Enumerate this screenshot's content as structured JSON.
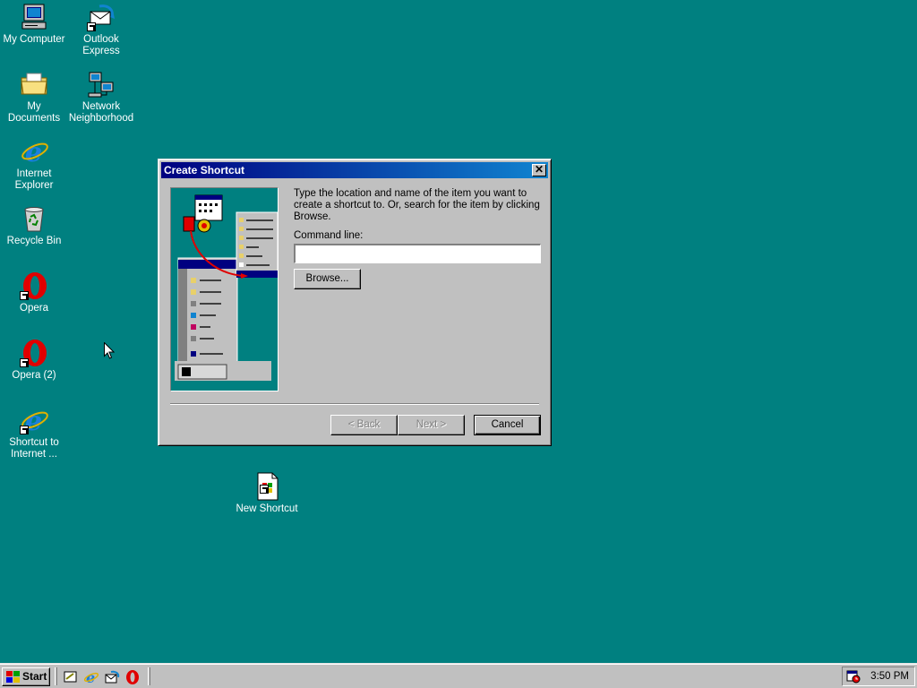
{
  "desktop": {
    "icons": [
      {
        "label": "My Computer",
        "icon": "computer-icon"
      },
      {
        "label": "Outlook\nExpress",
        "icon": "outlook-express-icon"
      },
      {
        "label": "My Documents",
        "icon": "folder-icon"
      },
      {
        "label": "Network\nNeighborhood",
        "icon": "network-icon"
      },
      {
        "label": "Internet\nExplorer",
        "icon": "internet-explorer-icon"
      },
      {
        "label": "Recycle Bin",
        "icon": "recycle-bin-icon"
      },
      {
        "label": "Opera",
        "icon": "opera-icon"
      },
      {
        "label": "Opera (2)",
        "icon": "opera-icon"
      },
      {
        "label": "Shortcut to\nInternet ...",
        "icon": "internet-explorer-icon"
      },
      {
        "label": "New Shortcut",
        "icon": "shortcut-file-icon"
      }
    ]
  },
  "dialog": {
    "title": "Create Shortcut",
    "instructions": "Type the location and name of the item you want to create a shortcut to. Or, search for the item by clicking Browse.",
    "command_label": "Command line:",
    "command_value": "",
    "browse_label": "Browse...",
    "back_label": "< Back",
    "next_label": "Next >",
    "cancel_label": "Cancel"
  },
  "taskbar": {
    "start_label": "Start",
    "quick_launch": [
      "show-desktop-icon",
      "internet-explorer-icon",
      "outlook-express-icon",
      "opera-icon"
    ],
    "clock": "3:50 PM"
  },
  "colors": {
    "desktop": "#008080",
    "titlebar_start": "#000080",
    "titlebar_end": "#1084d0",
    "face": "#c0c0c0"
  }
}
